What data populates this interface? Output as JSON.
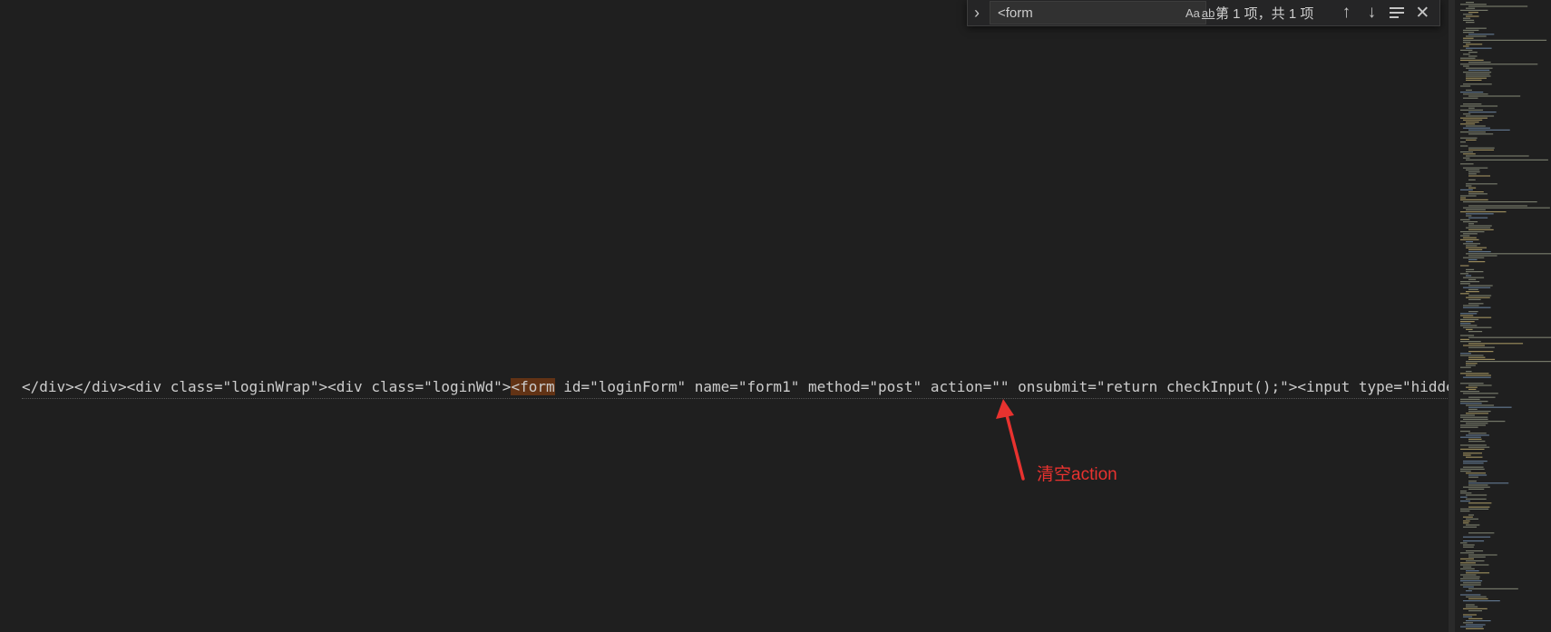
{
  "find": {
    "query": "<form",
    "match_case_label": "Aa",
    "whole_word_label": "ab",
    "regex_label": ".*",
    "result": "第 1 项，共 1 项"
  },
  "editor": {
    "segments": [
      "</div></div><div class=\"loginWrap\"><div class=\"loginWd\">",
      "<form",
      " id=\"loginForm\" name=\"form1\" method=\"post\" action=\"\" onsubmit=\"return checkInput();\"><input type=\"hidden"
    ]
  },
  "annotation": {
    "text": "清空action",
    "color": "#e8322f"
  },
  "colors": {
    "background": "#1f1f1f",
    "match_highlight": "#623315",
    "text": "#cccccc"
  }
}
